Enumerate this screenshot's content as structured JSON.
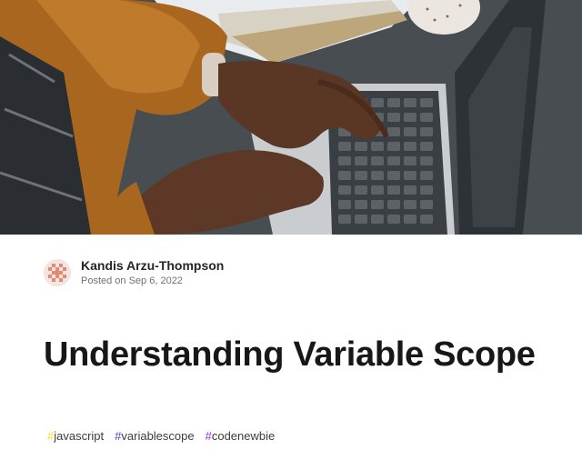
{
  "article": {
    "author": "Kandis Arzu-Thompson",
    "posted_prefix": "Posted on",
    "posted_date": "Sep 6, 2022",
    "posted_text": "Posted on Sep 6, 2022",
    "title": "Understanding Variable Scope",
    "tags": [
      {
        "name": "javascript",
        "hash_color": "#f7df1e"
      },
      {
        "name": "variablescope",
        "hash_color": "#3b49df"
      },
      {
        "name": "codenewbie",
        "hash_color": "#9b30ff"
      }
    ]
  },
  "colors": {
    "accent": "#3b49df",
    "text": "#171717",
    "muted": "#717171"
  },
  "icons": {
    "avatar": "pixel-identicon-avatar"
  }
}
